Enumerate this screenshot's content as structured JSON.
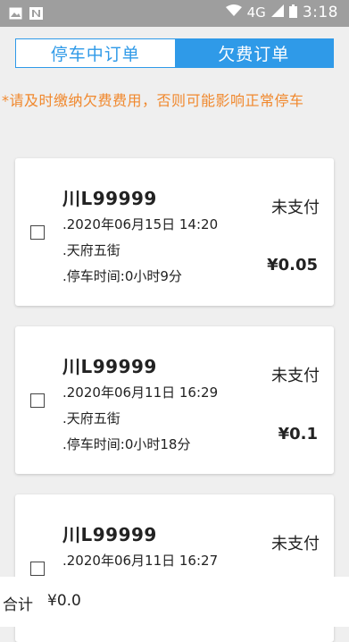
{
  "status_bar": {
    "network": "4G",
    "time": "3:18",
    "icons": [
      "gallery-icon",
      "notification-n-icon",
      "wifi-icon",
      "signal-icon",
      "battery-icon"
    ]
  },
  "tabs": [
    {
      "label": "停车中订单",
      "active": false
    },
    {
      "label": "欠费订单",
      "active": true
    }
  ],
  "notice": "*请及时缴纳欠费费用，否则可能影响正常停车",
  "orders": [
    {
      "plate": "川L99999",
      "time": ".2020年06月15日 14:20",
      "location": ".天府五街",
      "duration": ".停车时间:0小时9分",
      "status": "未支付",
      "amount": "¥0.05"
    },
    {
      "plate": "川L99999",
      "time": ".2020年06月11日 16:29",
      "location": ".天府五街",
      "duration": ".停车时间:0小时18分",
      "status": "未支付",
      "amount": "¥0.1"
    },
    {
      "plate": "川L99999",
      "time": ".2020年06月11日 16:27",
      "location": "",
      "duration": "",
      "status": "未支付",
      "amount": ""
    }
  ],
  "footer": {
    "total_label": "合计",
    "total_value": "¥0.0"
  },
  "colors": {
    "accent": "#2f9ae8",
    "warning": "#f0882d"
  }
}
